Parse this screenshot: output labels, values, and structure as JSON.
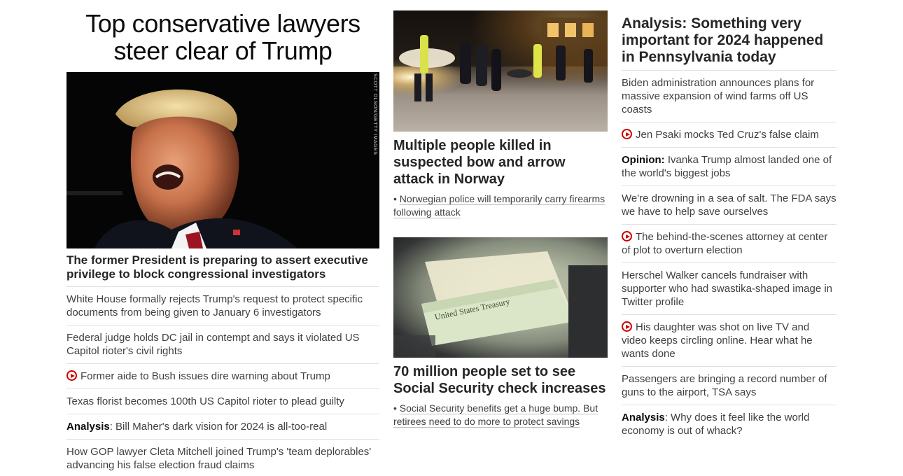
{
  "lead": {
    "headline": "Top conservative lawyers steer clear of Trump",
    "image_credit": "SCOTT OLSON/GETTY IMAGES",
    "caption": "The former President is preparing to assert executive privilege to block congressional investigators",
    "related": [
      {
        "prefix": "",
        "text": "White House formally rejects Trump's request to protect specific documents from being given to January 6 investigators",
        "video": false
      },
      {
        "prefix": "",
        "text": "Federal judge holds DC jail in contempt and says it violated US Capitol rioter's civil rights",
        "video": false
      },
      {
        "prefix": "",
        "text": "Former aide to Bush issues dire warning about Trump",
        "video": true
      },
      {
        "prefix": "",
        "text": "Texas florist becomes 100th US Capitol rioter to plead guilty",
        "video": false
      },
      {
        "prefix": "Analysis",
        "text": ": Bill Maher's dark vision for 2024 is all-too-real",
        "video": false
      },
      {
        "prefix": "",
        "text": "How GOP lawyer Cleta Mitchell joined Trump's 'team deplorables' advancing his false election fraud claims",
        "video": false
      }
    ]
  },
  "cards": [
    {
      "headline": "Multiple people killed in suspected bow and arrow attack in Norway",
      "sub": "Norwegian police will temporarily carry firearms following attack"
    },
    {
      "headline": "70 million people set to see Social Security check increases",
      "sub": "Social Security benefits get a huge bump. But retirees need to do more to protect savings"
    }
  ],
  "right": {
    "headline": "Analysis: Something very important for 2024 happened in Pennsylvania today",
    "items": [
      {
        "prefix": "",
        "text": "Biden administration announces plans for massive expansion of wind farms off US coasts",
        "video": false
      },
      {
        "prefix": "",
        "text": "Jen Psaki mocks Ted Cruz's false claim",
        "video": true
      },
      {
        "prefix": "Opinion:",
        "text": " Ivanka Trump almost landed one of the world's biggest jobs",
        "video": false
      },
      {
        "prefix": "",
        "text": "We're drowning in a sea of salt. The FDA says we have to help save ourselves",
        "video": false
      },
      {
        "prefix": "",
        "text": "The behind-the-scenes attorney at center of plot to overturn election",
        "video": true
      },
      {
        "prefix": "",
        "text": "Herschel Walker cancels fundraiser with supporter who had swastika-shaped image in Twitter profile",
        "video": false
      },
      {
        "prefix": "",
        "text": "His daughter was shot on live TV and video keeps circling online. Hear what he wants done",
        "video": true
      },
      {
        "prefix": "",
        "text": "Passengers are bringing a record number of guns to the airport, TSA says",
        "video": false
      },
      {
        "prefix": "Analysis",
        "text": ": Why does it feel like the world economy is out of whack?",
        "video": false
      }
    ]
  },
  "colors": {
    "accent_red": "#cc0000",
    "divider": "#e0e0e0",
    "text_dark": "#0c0c0c"
  }
}
